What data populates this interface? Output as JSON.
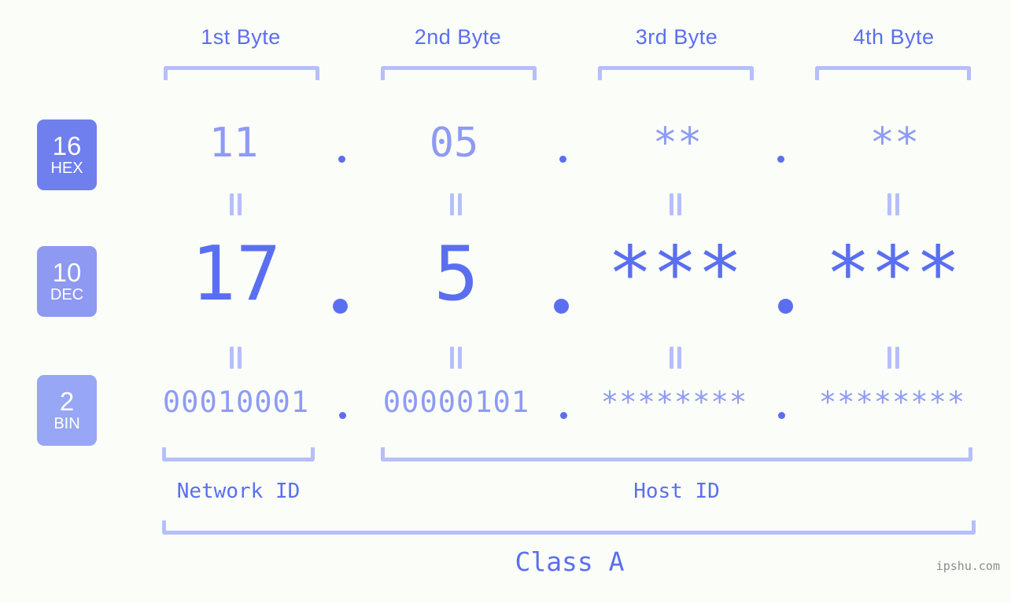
{
  "meta": {
    "background_color": "#fbfdf8",
    "accent_color": "#5a6ff0",
    "accent_light_color": "#8e9bf4",
    "bracket_color": "#b6bffb",
    "watermark": "ipshu.com"
  },
  "byte_headers": [
    {
      "label": "1st Byte"
    },
    {
      "label": "2nd Byte"
    },
    {
      "label": "3rd Byte"
    },
    {
      "label": "4th Byte"
    }
  ],
  "rows": [
    {
      "badge_number": "16",
      "badge_abbr": "HEX",
      "badge_color": "#6f7fee",
      "values": [
        "11",
        "05",
        "**",
        "**"
      ]
    },
    {
      "badge_number": "10",
      "badge_abbr": "DEC",
      "badge_color": "#8e99f2",
      "values": [
        "17",
        "5",
        "***",
        "***"
      ]
    },
    {
      "badge_number": "2",
      "badge_abbr": "BIN",
      "badge_color": "#97a6f5",
      "values": [
        "00010001",
        "00000101",
        "********",
        "********"
      ]
    }
  ],
  "separators": {
    "dot": ".",
    "equality": "="
  },
  "id_labels": [
    {
      "label": "Network ID"
    },
    {
      "label": "Host ID"
    }
  ],
  "class_label": "Class A"
}
